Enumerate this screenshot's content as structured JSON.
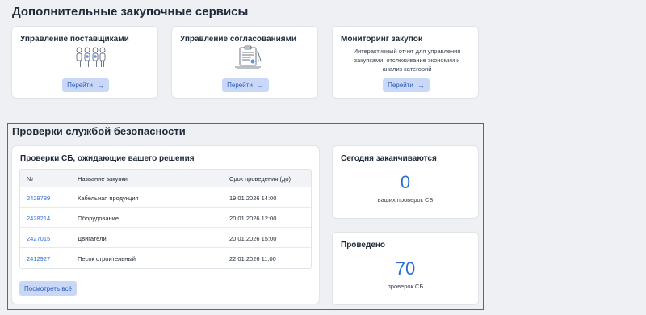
{
  "services": {
    "title": "Дополнительные закупочные сервисы",
    "cards": [
      {
        "title": "Управление поставщиками",
        "button": "Перейти"
      },
      {
        "title": "Управление согласованиями",
        "button": "Перейти"
      },
      {
        "title": "Мониторинг закупок",
        "description": "Интерактивный отчет для управления закупками: отслеживание экономии и анализ категорий",
        "button": "Перейти"
      }
    ]
  },
  "security": {
    "title": "Проверки службой безопасности",
    "pending": {
      "title": "Проверки СБ, ожидающие вашего решения",
      "columns": [
        "№",
        "Название закупки",
        "Срок проведения (до)"
      ],
      "rows": [
        {
          "id": "2429789",
          "name": "Кабельная продукция",
          "deadline": "19.01.2026 14:00"
        },
        {
          "id": "2428214",
          "name": "Оборудование",
          "deadline": "20.01.2026 12:00"
        },
        {
          "id": "2427015",
          "name": "Двигатели",
          "deadline": "20.01.2026 15:00"
        },
        {
          "id": "2412927",
          "name": "Песок строительный",
          "deadline": "22.01.2026 11:00"
        }
      ],
      "view_all": "Посмотреть всё"
    },
    "ending_today": {
      "title": "Сегодня заканчиваются",
      "value": "0",
      "caption": "ваших проверок СБ"
    },
    "done": {
      "title": "Проведено",
      "value": "70",
      "caption": "проверок СБ"
    }
  },
  "colors": {
    "accent": "#2a6fd6",
    "button_bg": "#c9d8f7",
    "highlight_border": "#e03131",
    "page_bg": "#eef0f4"
  }
}
